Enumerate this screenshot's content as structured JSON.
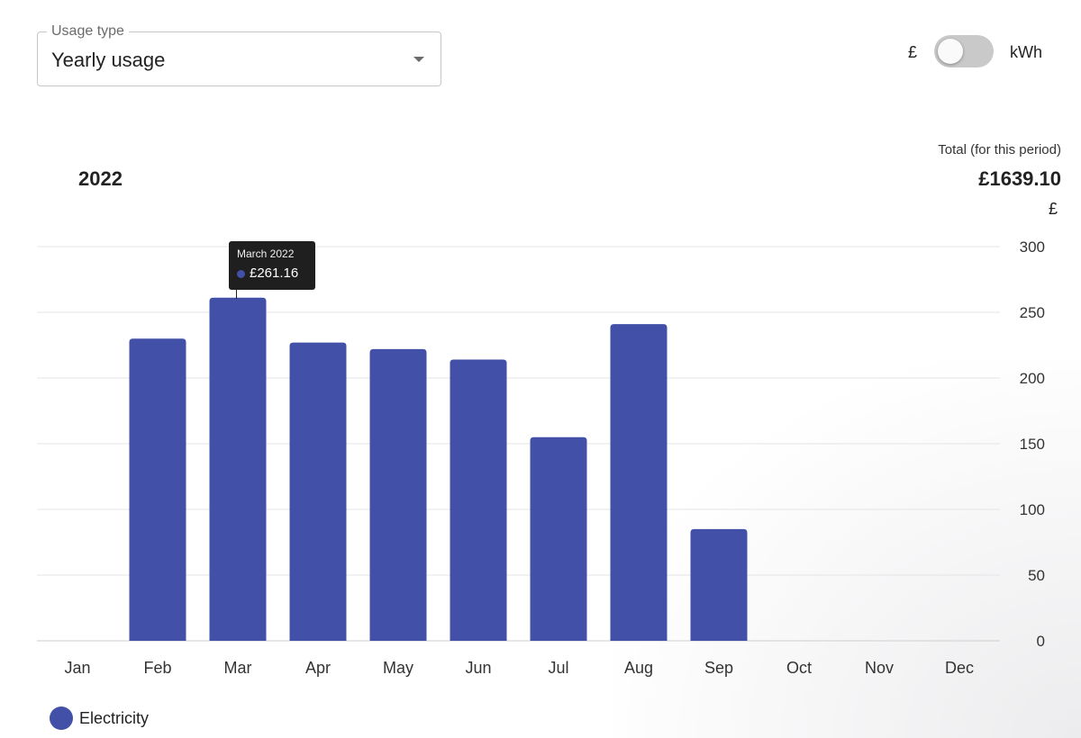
{
  "select": {
    "label": "Usage type",
    "value": "Yearly usage"
  },
  "toggle": {
    "left_label": "£",
    "right_label": "kWh",
    "on": false
  },
  "header": {
    "year": "2022",
    "total_label": "Total (for this period)",
    "total_value": "£1639.10",
    "unit": "£"
  },
  "tooltip": {
    "title": "March 2022",
    "value": "£261.16"
  },
  "legend": {
    "label": "Electricity"
  },
  "colors": {
    "bar": "#4250a7",
    "grid": "#e4e4e4",
    "axis_text": "#333333"
  },
  "chart_data": {
    "type": "bar",
    "categories": [
      "Jan",
      "Feb",
      "Mar",
      "Apr",
      "May",
      "Jun",
      "Jul",
      "Aug",
      "Sep",
      "Oct",
      "Nov",
      "Dec"
    ],
    "series": [
      {
        "name": "Electricity",
        "values": [
          null,
          230,
          261.16,
          227,
          222,
          214,
          155,
          241,
          85,
          null,
          null,
          null
        ]
      }
    ],
    "ylim": [
      0,
      300
    ],
    "yticks": [
      0,
      50,
      100,
      150,
      200,
      250,
      300
    ],
    "ylabel": "£",
    "grid": true,
    "legend_position": "bottom-left"
  }
}
